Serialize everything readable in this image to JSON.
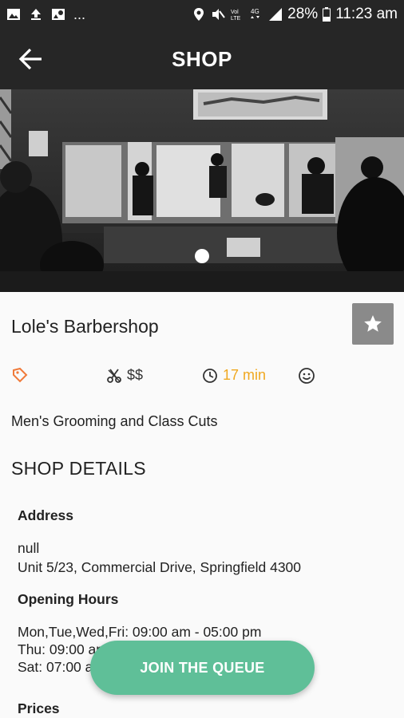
{
  "status_bar": {
    "time": "11:23 am",
    "battery": "28%",
    "more": "...",
    "icons": [
      "image-icon",
      "upload-icon",
      "download-icon",
      "location-icon",
      "mute-icon",
      "volte-icon",
      "4g-icon",
      "signal-icon",
      "battery-icon"
    ]
  },
  "app_bar": {
    "title": "SHOP",
    "back_icon": "arrow-back-icon"
  },
  "shop": {
    "name": "Lole's Barbershop",
    "favorite_icon": "star-icon",
    "price": "$$",
    "wait_time": "17 min",
    "tagline": "Men's Grooming and Class Cuts",
    "hero_pages": 1,
    "hero_current_page": 1
  },
  "details": {
    "section_title": "SHOP DETAILS",
    "address_label": "Address",
    "address_line1": "null",
    "address_line2": "Unit 5/23, Commercial Drive, Springfield 4300",
    "hours_label": "Opening Hours",
    "hours_line1": "Mon,Tue,Wed,Fri: 09:00 am - 05:00 pm",
    "hours_line2": "Thu: 09:00 am - 07:00 pm",
    "hours_line3": "Sat: 07:00 am - 12:00 pm",
    "prices_label": "Prices"
  },
  "action": {
    "join_label": "JOIN THE QUEUE"
  },
  "colors": {
    "bar": "#262626",
    "accent_green": "#5fbf98",
    "wait_orange": "#f0a820",
    "tag_orange": "#f07a3a"
  }
}
